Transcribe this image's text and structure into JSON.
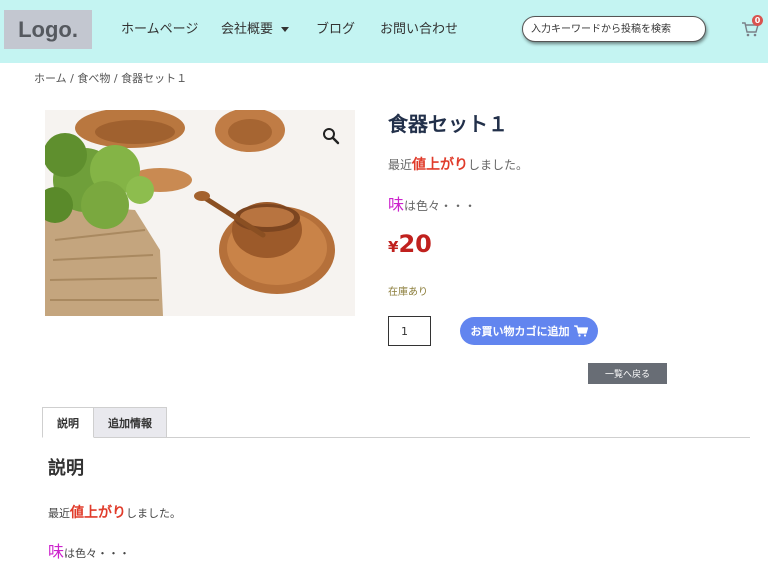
{
  "header": {
    "logo": "Logo.",
    "nav": {
      "home": "ホームページ",
      "about": "会社概要",
      "blog": "ブログ",
      "contact": "お問い合わせ"
    },
    "search_placeholder": "入力キーワードから投稿を検索",
    "cart_count": "0",
    "cart_icon": "cart-icon"
  },
  "breadcrumb": "ホーム / 食べ物 / 食器セット１",
  "product": {
    "title": "食器セット１",
    "desc1": {
      "pre": "最近",
      "emph": "値上がり",
      "post": "しました。"
    },
    "desc2": {
      "emph": "味",
      "post": "は色々・・・"
    },
    "price_symbol": "¥",
    "price": "20",
    "stock": "在庫あり",
    "quantity": "1",
    "add_to_cart": "お買い物カゴに追加",
    "back": "一覧へ戻る",
    "zoom_icon": "magnifier-icon"
  },
  "tabs": {
    "description": "説明",
    "additional": "追加情報"
  },
  "description_section": {
    "title": "説明",
    "line1": {
      "pre": "最近",
      "emph": "値上がり",
      "post": "しました。"
    },
    "line2": {
      "emph": "味",
      "post": "は色々・・・"
    }
  },
  "colors": {
    "header_bg": "#c4f4f2",
    "accent_button": "#6285ef",
    "price": "#c0211e",
    "emph_red": "#e03b2a",
    "emph_magenta": "#cc22cc"
  }
}
